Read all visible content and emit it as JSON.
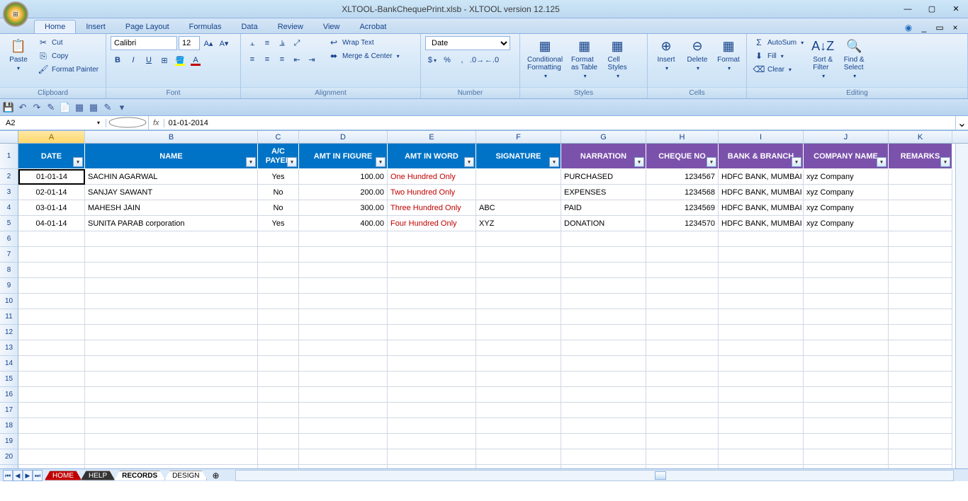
{
  "title": "XLTOOL-BankChequePrint.xlsb - XLTOOL version 12.125",
  "tabs": [
    "Home",
    "Insert",
    "Page Layout",
    "Formulas",
    "Data",
    "Review",
    "View",
    "Acrobat"
  ],
  "activeTab": "Home",
  "clipboard": {
    "paste": "Paste",
    "cut": "Cut",
    "copy": "Copy",
    "painter": "Format Painter",
    "label": "Clipboard"
  },
  "font": {
    "face": "Calibri",
    "size": "12",
    "label": "Font"
  },
  "alignment": {
    "wrap": "Wrap Text",
    "merge": "Merge & Center",
    "label": "Alignment"
  },
  "number": {
    "format": "Date",
    "label": "Number"
  },
  "styles": {
    "cond": "Conditional\nFormatting",
    "table": "Format\nas Table",
    "cell": "Cell\nStyles",
    "label": "Styles"
  },
  "cells": {
    "insert": "Insert",
    "delete": "Delete",
    "format": "Format",
    "label": "Cells"
  },
  "editing": {
    "autosum": "AutoSum",
    "fill": "Fill",
    "clear": "Clear",
    "sort": "Sort &\nFilter",
    "find": "Find &\nSelect",
    "label": "Editing"
  },
  "namebox": "A2",
  "formula": "01-01-2014",
  "colLetters": [
    "A",
    "B",
    "C",
    "D",
    "E",
    "F",
    "G",
    "H",
    "I",
    "J",
    "K"
  ],
  "headers": [
    "DATE",
    "NAME",
    "A/C PAYEE",
    "AMT IN FIGURE",
    "AMT IN WORD",
    "SIGNATURE",
    "NARRATION",
    "CHEQUE NO",
    "BANK & BRANCH",
    "COMPANY NAME",
    "REMARKS"
  ],
  "rows": [
    {
      "date": "01-01-14",
      "name": "SACHIN AGARWAL",
      "payee": "Yes",
      "fig": "100.00",
      "word": "One Hundred  Only",
      "sig": "",
      "narr": "PURCHASED",
      "chq": "1234567",
      "bank": "HDFC BANK, MUMBAI",
      "co": "xyz Company",
      "rem": ""
    },
    {
      "date": "02-01-14",
      "name": "SANJAY SAWANT",
      "payee": "No",
      "fig": "200.00",
      "word": "Two Hundred  Only",
      "sig": "",
      "narr": "EXPENSES",
      "chq": "1234568",
      "bank": "HDFC BANK, MUMBAI",
      "co": "xyz Company",
      "rem": ""
    },
    {
      "date": "03-01-14",
      "name": "MAHESH JAIN",
      "payee": "No",
      "fig": "300.00",
      "word": "Three Hundred  Only",
      "sig": "ABC",
      "narr": "PAID",
      "chq": "1234569",
      "bank": "HDFC BANK, MUMBAI",
      "co": "xyz Company",
      "rem": ""
    },
    {
      "date": "04-01-14",
      "name": "SUNITA PARAB corporation",
      "payee": "Yes",
      "fig": "400.00",
      "word": "Four Hundred  Only",
      "sig": "XYZ",
      "narr": "DONATION",
      "chq": "1234570",
      "bank": "HDFC BANK, MUMBAI",
      "co": "xyz Company",
      "rem": ""
    }
  ],
  "sheets": [
    "HOME",
    "HELP",
    "RECORDS",
    "DESIGN"
  ],
  "activeSheet": "RECORDS"
}
